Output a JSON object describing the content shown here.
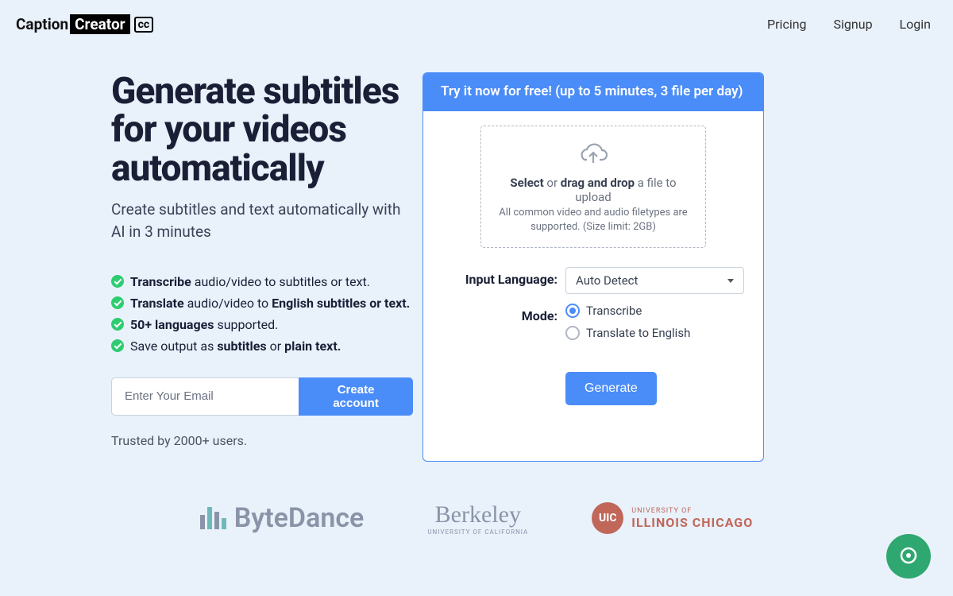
{
  "brand": {
    "part1": "Caption",
    "part2": "Creator",
    "badge": "cc"
  },
  "nav": {
    "pricing": "Pricing",
    "signup": "Signup",
    "login": "Login"
  },
  "hero": {
    "title": "Generate subtitles for your videos automatically",
    "subtitle": "Create subtitles and text automatically with AI in 3 minutes"
  },
  "features": {
    "f1_b": "Transcribe",
    "f1_rest": " audio/video to subtitles or text.",
    "f2_b": "Translate",
    "f2_mid": " audio/video to ",
    "f2_b2": "English subtitles or text.",
    "f3_b": "50+ languages",
    "f3_rest": " supported.",
    "f4_pre": "Save output as ",
    "f4_b1": "subtitles",
    "f4_mid": " or ",
    "f4_b2": "plain text."
  },
  "email": {
    "placeholder": "Enter Your Email",
    "cta": "Create account"
  },
  "trusted": "Trusted by 2000+ users.",
  "panel": {
    "header": "Try it now for free! (up to 5 minutes, 3 file per day)",
    "drop_select": "Select",
    "drop_or": " or ",
    "drop_dnd": "drag and drop",
    "drop_tail": " a file to upload",
    "drop_sub": "All common video and audio filetypes are supported. (Size limit: 2GB)",
    "lang_label": "Input Language:",
    "lang_value": "Auto Detect",
    "mode_label": "Mode:",
    "mode_transcribe": "Transcribe",
    "mode_translate": "Translate to English",
    "generate": "Generate"
  },
  "logos": {
    "bytedance": "ByteDance",
    "berkeley_big": "Berkeley",
    "berkeley_small": "UNIVERSITY OF CALIFORNIA",
    "uic_badge": "UIC",
    "uic_l1": "UNIVERSITY OF",
    "uic_l2": "ILLINOIS CHICAGO"
  }
}
